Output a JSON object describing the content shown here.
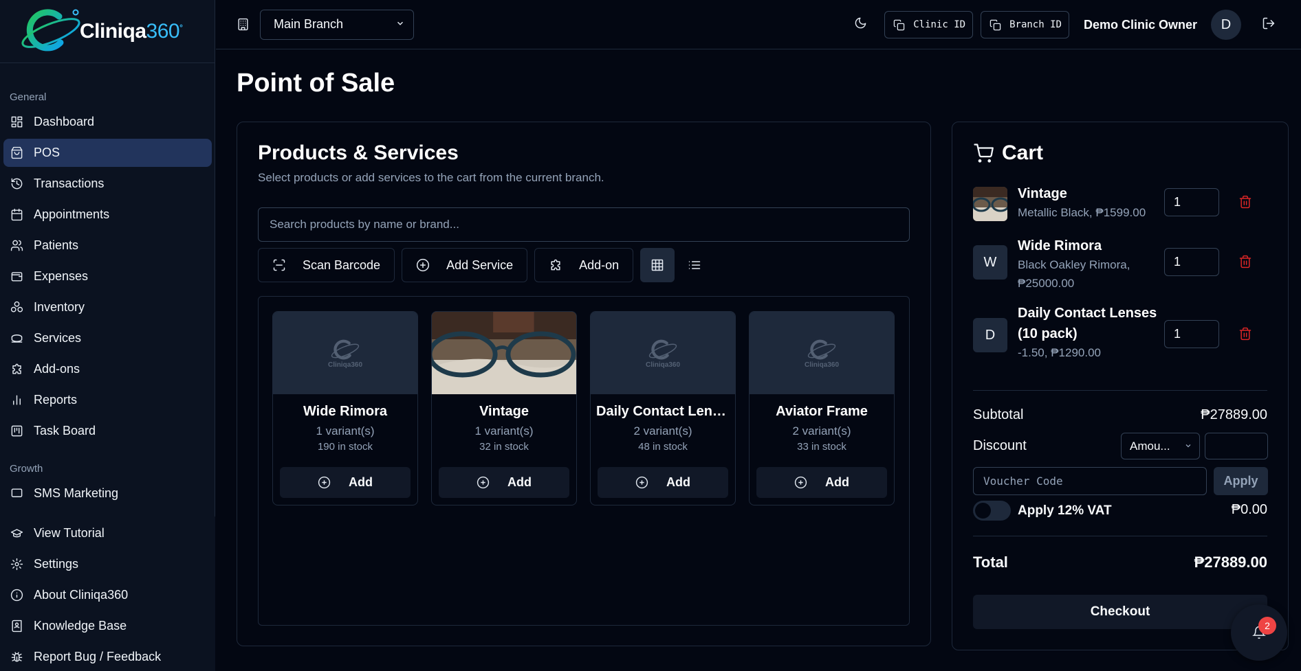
{
  "brand": {
    "name_main": "Cliniqa",
    "name_accent": "360",
    "trademark": "°"
  },
  "sidebar": {
    "section_general": "General",
    "items": [
      {
        "label": "Dashboard",
        "icon": "dashboard-icon"
      },
      {
        "label": "POS",
        "icon": "shopping-bag-icon",
        "active": true
      },
      {
        "label": "Transactions",
        "icon": "history-icon"
      },
      {
        "label": "Appointments",
        "icon": "calendar-icon"
      },
      {
        "label": "Patients",
        "icon": "users-icon"
      },
      {
        "label": "Expenses",
        "icon": "wallet-icon"
      },
      {
        "label": "Inventory",
        "icon": "boxes-icon"
      },
      {
        "label": "Services",
        "icon": "hand-coins-icon"
      },
      {
        "label": "Add-ons",
        "icon": "puzzle-icon"
      },
      {
        "label": "Reports",
        "icon": "bar-chart-icon"
      },
      {
        "label": "Task Board",
        "icon": "kanban-icon"
      }
    ],
    "section_growth": "Growth",
    "growth_items": [
      {
        "label": "SMS Marketing",
        "icon": "message-icon"
      }
    ],
    "bottom_items": [
      {
        "label": "View Tutorial",
        "icon": "graduation-cap-icon"
      },
      {
        "label": "Settings",
        "icon": "gear-icon"
      },
      {
        "label": "About Cliniqa360",
        "icon": "info-icon"
      },
      {
        "label": "Knowledge Base",
        "icon": "book-user-icon"
      },
      {
        "label": "Report Bug / Feedback",
        "icon": "bug-icon"
      }
    ]
  },
  "topbar": {
    "branch_selected": "Main Branch",
    "clinic_id_label": "Clinic ID",
    "branch_id_label": "Branch ID",
    "owner_name": "Demo Clinic Owner",
    "avatar_initial": "D"
  },
  "page": {
    "title": "Point of Sale"
  },
  "products": {
    "title": "Products & Services",
    "subtitle": "Select products or add services to the cart from the current branch.",
    "search_placeholder": "Search products by name or brand...",
    "buttons": {
      "scan": "Scan Barcode",
      "add_service": "Add Service",
      "add_on": "Add-on"
    },
    "placeholder_logo_text": "Cliniqa360",
    "items": [
      {
        "name": "Wide Rimora",
        "variants": "1 variant(s)",
        "stock": "190 in stock",
        "add": "Add"
      },
      {
        "name": "Vintage",
        "variants": "1 variant(s)",
        "stock": "32 in stock",
        "add": "Add"
      },
      {
        "name": "Daily Contact Lenses (10 pack)",
        "variants": "2 variant(s)",
        "stock": "48 in stock",
        "add": "Add"
      },
      {
        "name": "Aviator Frame",
        "variants": "2 variant(s)",
        "stock": "33 in stock",
        "add": "Add"
      }
    ]
  },
  "cart": {
    "title": "Cart",
    "items": [
      {
        "initial": "",
        "name": "Vintage",
        "desc": "Metallic Black, ₱1599.00",
        "qty": "1"
      },
      {
        "initial": "W",
        "name": "Wide Rimora",
        "desc": "Black Oakley Rimora, ₱25000.00",
        "qty": "1"
      },
      {
        "initial": "D",
        "name": "Daily Contact Lenses (10 pack)",
        "desc": "-1.50, ₱1290.00",
        "qty": "1"
      }
    ],
    "subtotal_label": "Subtotal",
    "subtotal_value": "₱27889.00",
    "discount_label": "Discount",
    "discount_type": "Amou...",
    "voucher_placeholder": "Voucher Code",
    "apply_label": "Apply",
    "vat_label": "Apply 12% VAT",
    "vat_value": "₱0.00",
    "total_label": "Total",
    "total_value": "₱27889.00",
    "checkout_label": "Checkout"
  },
  "notifications": {
    "count": "2"
  },
  "colors": {
    "background": "#030712",
    "sidebar": "#0b1220",
    "active_nav": "#22345c",
    "danger": "#dc2626",
    "badge": "#ef4444"
  }
}
